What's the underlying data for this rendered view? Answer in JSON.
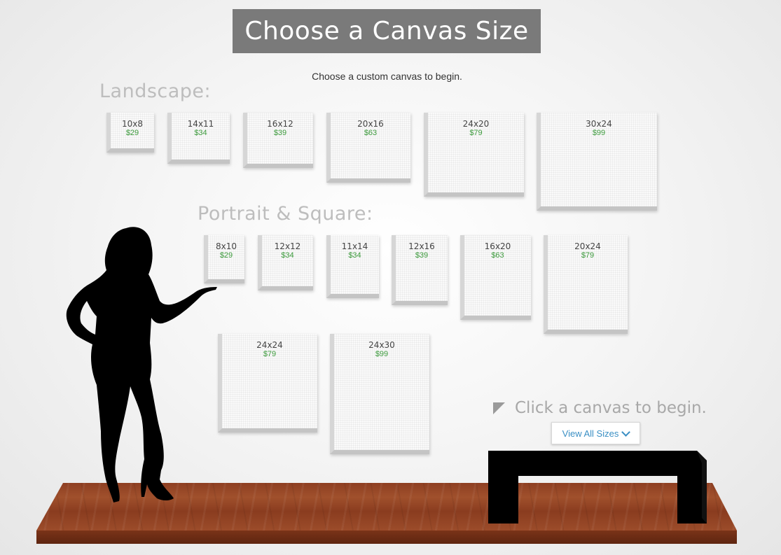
{
  "header": {
    "title": "Choose a Canvas Size",
    "subtitle": "Choose a custom canvas to begin."
  },
  "landscape": {
    "label": "Landscape:",
    "items": [
      {
        "size": "10x8",
        "price": "$29"
      },
      {
        "size": "14x11",
        "price": "$34"
      },
      {
        "size": "16x12",
        "price": "$39"
      },
      {
        "size": "20x16",
        "price": "$63"
      },
      {
        "size": "24x20",
        "price": "$79"
      },
      {
        "size": "30x24",
        "price": "$99"
      }
    ]
  },
  "portrait": {
    "label": "Portrait & Square:",
    "items": [
      {
        "size": "8x10",
        "price": "$29"
      },
      {
        "size": "12x12",
        "price": "$34"
      },
      {
        "size": "11x14",
        "price": "$34"
      },
      {
        "size": "12x16",
        "price": "$39"
      },
      {
        "size": "16x20",
        "price": "$63"
      },
      {
        "size": "20x24",
        "price": "$79"
      },
      {
        "size": "24x24",
        "price": "$79"
      },
      {
        "size": "24x30",
        "price": "$99"
      }
    ]
  },
  "hint": {
    "text": "Click a canvas to begin.",
    "button_label": "View All Sizes"
  },
  "colors": {
    "title_bg": "#7a7a7a",
    "price": "#3c9a3c",
    "link": "#3a8fc4",
    "floor": "#9a4a28"
  }
}
